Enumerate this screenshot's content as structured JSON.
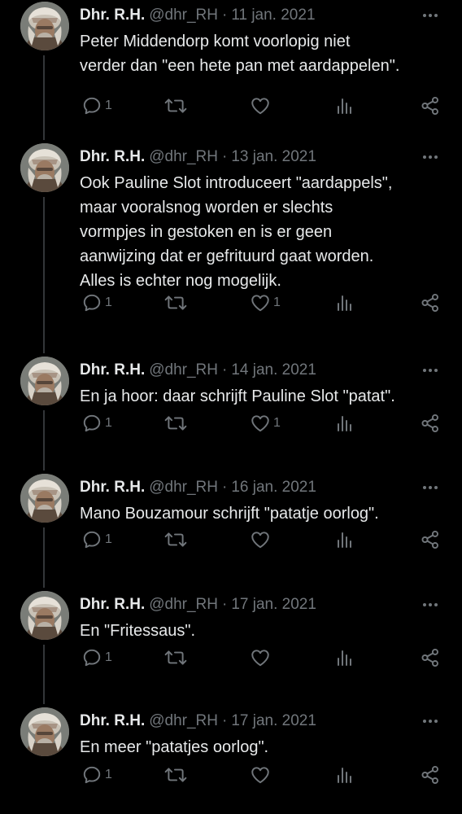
{
  "colors": {
    "background": "#000000",
    "text_primary": "#e7e9ea",
    "text_secondary": "#71767b",
    "thread_line": "#333639"
  },
  "icons": {
    "reply": "reply-icon",
    "retweet": "retweet-icon",
    "like": "like-icon",
    "views": "views-icon",
    "share": "share-icon",
    "more": "more-options-icon"
  },
  "tweets": [
    {
      "author_name": "Dhr. R.H.",
      "handle": "@dhr_RH",
      "separator": "·",
      "date": "11 jan. 2021",
      "lines": [
        "Peter Middendorp komt voorlopig niet",
        "verder dan \"een hete pan met aardappelen\"."
      ],
      "reply_count": "1",
      "retweet_count": "",
      "like_count": ""
    },
    {
      "author_name": "Dhr. R.H.",
      "handle": "@dhr_RH",
      "separator": "·",
      "date": "13 jan. 2021",
      "lines": [
        "Ook Pauline Slot introduceert \"aardappels\",",
        "maar vooralsnog worden er slechts",
        "vormpjes in gestoken en is er geen",
        "aanwijzing dat er gefrituurd gaat worden.",
        "Alles is echter nog mogelijk."
      ],
      "reply_count": "1",
      "retweet_count": "",
      "like_count": "1"
    },
    {
      "author_name": "Dhr. R.H.",
      "handle": "@dhr_RH",
      "separator": "·",
      "date": "14 jan. 2021",
      "lines": [
        "En ja hoor: daar schrijft Pauline Slot \"patat\"."
      ],
      "reply_count": "1",
      "retweet_count": "",
      "like_count": "1"
    },
    {
      "author_name": "Dhr. R.H.",
      "handle": "@dhr_RH",
      "separator": "·",
      "date": "16 jan. 2021",
      "lines": [
        "Mano Bouzamour schrijft \"patatje oorlog\"."
      ],
      "reply_count": "1",
      "retweet_count": "",
      "like_count": ""
    },
    {
      "author_name": "Dhr. R.H.",
      "handle": "@dhr_RH",
      "separator": "·",
      "date": "17 jan. 2021",
      "lines": [
        "En \"Fritessaus\"."
      ],
      "reply_count": "1",
      "retweet_count": "",
      "like_count": ""
    },
    {
      "author_name": "Dhr. R.H.",
      "handle": "@dhr_RH",
      "separator": "·",
      "date": "17 jan. 2021",
      "lines": [
        "En meer \"patatjes oorlog\"."
      ],
      "reply_count": "1",
      "retweet_count": "",
      "like_count": ""
    }
  ]
}
